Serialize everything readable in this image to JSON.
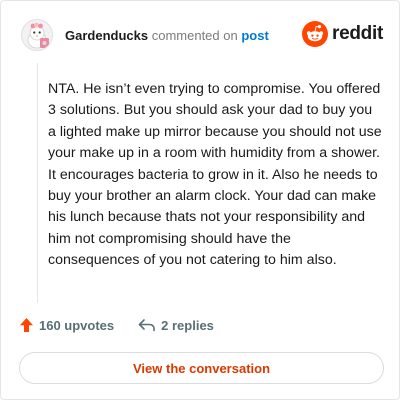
{
  "header": {
    "username": "Gardenducks",
    "action_text": "commented on",
    "target": "post",
    "avatar_icon": "avatar-icon",
    "brand_icon": "reddit-logo-icon",
    "brand_name": "reddit"
  },
  "comment": {
    "body": "NTA. He isn’t even trying to compromise. You offered 3 solutions. But you should ask your dad to buy you a lighted make up mirror because you should not use your make up in a room with humidity from a shower. It encourages bacteria to grow in it. Also he needs to buy your brother an alarm clock. Your dad can make his lunch because thats not your responsibility and him not compromising should have the consequences of you not catering to him also."
  },
  "actions": {
    "upvotes": "160 upvotes",
    "upvote_icon": "upvote-arrow-icon",
    "replies": "2 replies",
    "reply_icon": "reply-arrow-icon"
  },
  "footer": {
    "view_button": "View the conversation"
  },
  "colors": {
    "brand_orange": "#ff4500",
    "link_blue": "#0079d3",
    "button_text": "#d93a00",
    "muted": "#576f76"
  }
}
